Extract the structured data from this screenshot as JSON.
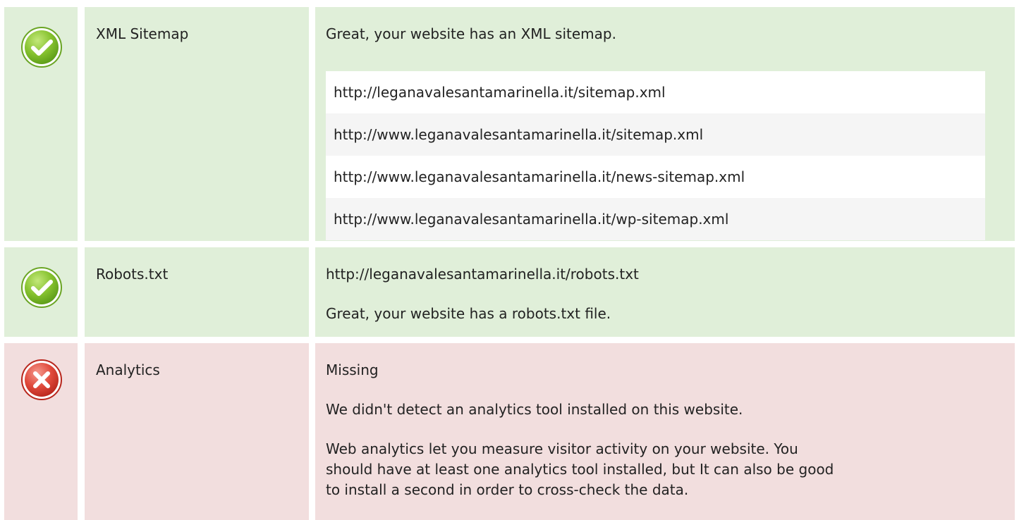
{
  "colors": {
    "pass_background": "#e0efd9",
    "fail_background": "#f2dede",
    "pass_icon": "#79b72a",
    "fail_icon": "#d93a3a"
  },
  "checks": [
    {
      "status": "pass",
      "icon": "check-circle-icon",
      "label": "XML Sitemap",
      "message": "Great, your website has an XML sitemap.",
      "urls": [
        "http://leganavalesantamarinella.it/sitemap.xml",
        "http://www.leganavalesantamarinella.it/sitemap.xml",
        "http://www.leganavalesantamarinella.it/news-sitemap.xml",
        "http://www.leganavalesantamarinella.it/wp-sitemap.xml"
      ]
    },
    {
      "status": "pass",
      "icon": "check-circle-icon",
      "label": "Robots.txt",
      "url": "http://leganavalesantamarinella.it/robots.txt",
      "message": "Great, your website has a robots.txt file."
    },
    {
      "status": "fail",
      "icon": "x-circle-icon",
      "label": "Analytics",
      "summary": "Missing",
      "message": "We didn't detect an analytics tool installed on this website.",
      "detail": "Web analytics let you measure visitor activity on your website. You should have at least one analytics tool installed, but It can also be good to install a second in order to cross-check the data."
    }
  ]
}
